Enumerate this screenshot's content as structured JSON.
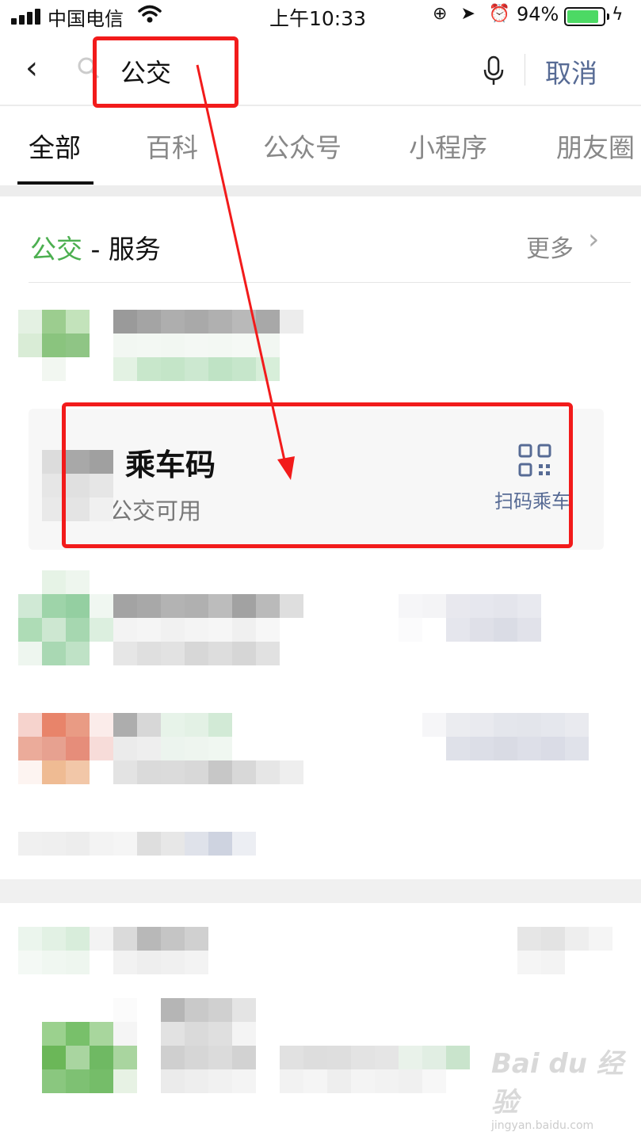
{
  "status_bar": {
    "carrier": "中国电信",
    "time": "上午10:33",
    "battery_percent": "94%",
    "battery_level": 0.94,
    "icons": [
      "signal-icon",
      "wifi-icon",
      "rotation-lock-icon",
      "location-icon",
      "alarm-icon",
      "battery-icon",
      "charging-icon"
    ]
  },
  "search": {
    "query": "公交",
    "cancel_label": "取消"
  },
  "tabs": [
    {
      "label": "全部",
      "active": true
    },
    {
      "label": "百科",
      "active": false
    },
    {
      "label": "公众号",
      "active": false
    },
    {
      "label": "小程序",
      "active": false
    },
    {
      "label": "朋友圈",
      "active": false
    }
  ],
  "section": {
    "keyword": "公交",
    "title_suffix": " - 服务",
    "more_label": "更多"
  },
  "service_card": {
    "title": "乘车码",
    "subtitle": "公交可用",
    "action_label": "扫码乘车",
    "action_icon": "qr-code-icon"
  },
  "watermark": {
    "brand": "Bai du 经验",
    "url": "jingyan.baidu.com"
  },
  "colors": {
    "accent_green": "#4caf50",
    "link_blue": "#576b95",
    "annotation_red": "#f21b1b"
  }
}
